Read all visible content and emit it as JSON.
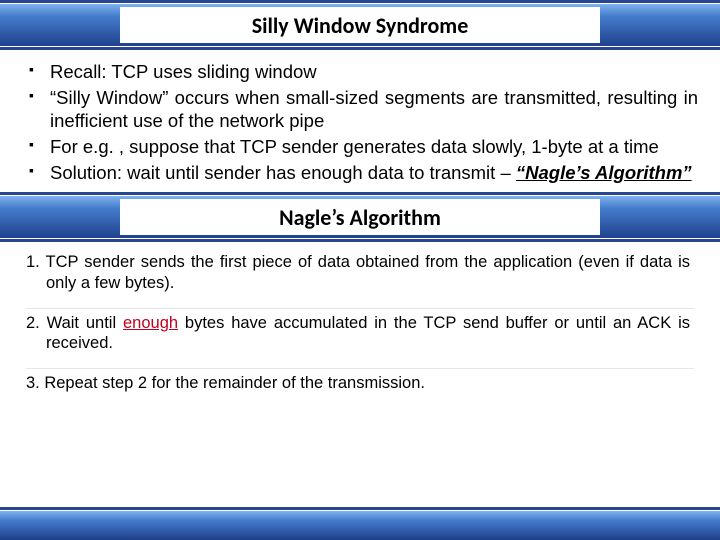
{
  "header1": "Silly Window Syndrome",
  "bullets": {
    "b1": "Recall: TCP uses sliding window",
    "b2": "“Silly Window” occurs when small-sized segments are transmitted, resulting in inefficient use of the network pipe",
    "b3": "For e.g. , suppose that TCP sender generates data slowly, 1-byte at a time",
    "b4_pre": "Solution: wait until sender has enough data to transmit – ",
    "b4_em": "“Nagle’s Algorithm”"
  },
  "header2": "Nagle’s Algorithm",
  "steps": {
    "s1": "1. TCP sender sends the first piece of data obtained from the application (even if data is only a few bytes).",
    "s2_pre": "2. Wait until ",
    "s2_enough": "enough",
    "s2_post": " bytes have accumulated in the TCP send buffer or until an ACK is received.",
    "s3": "3. Repeat step 2 for the remainder of the transmission."
  }
}
